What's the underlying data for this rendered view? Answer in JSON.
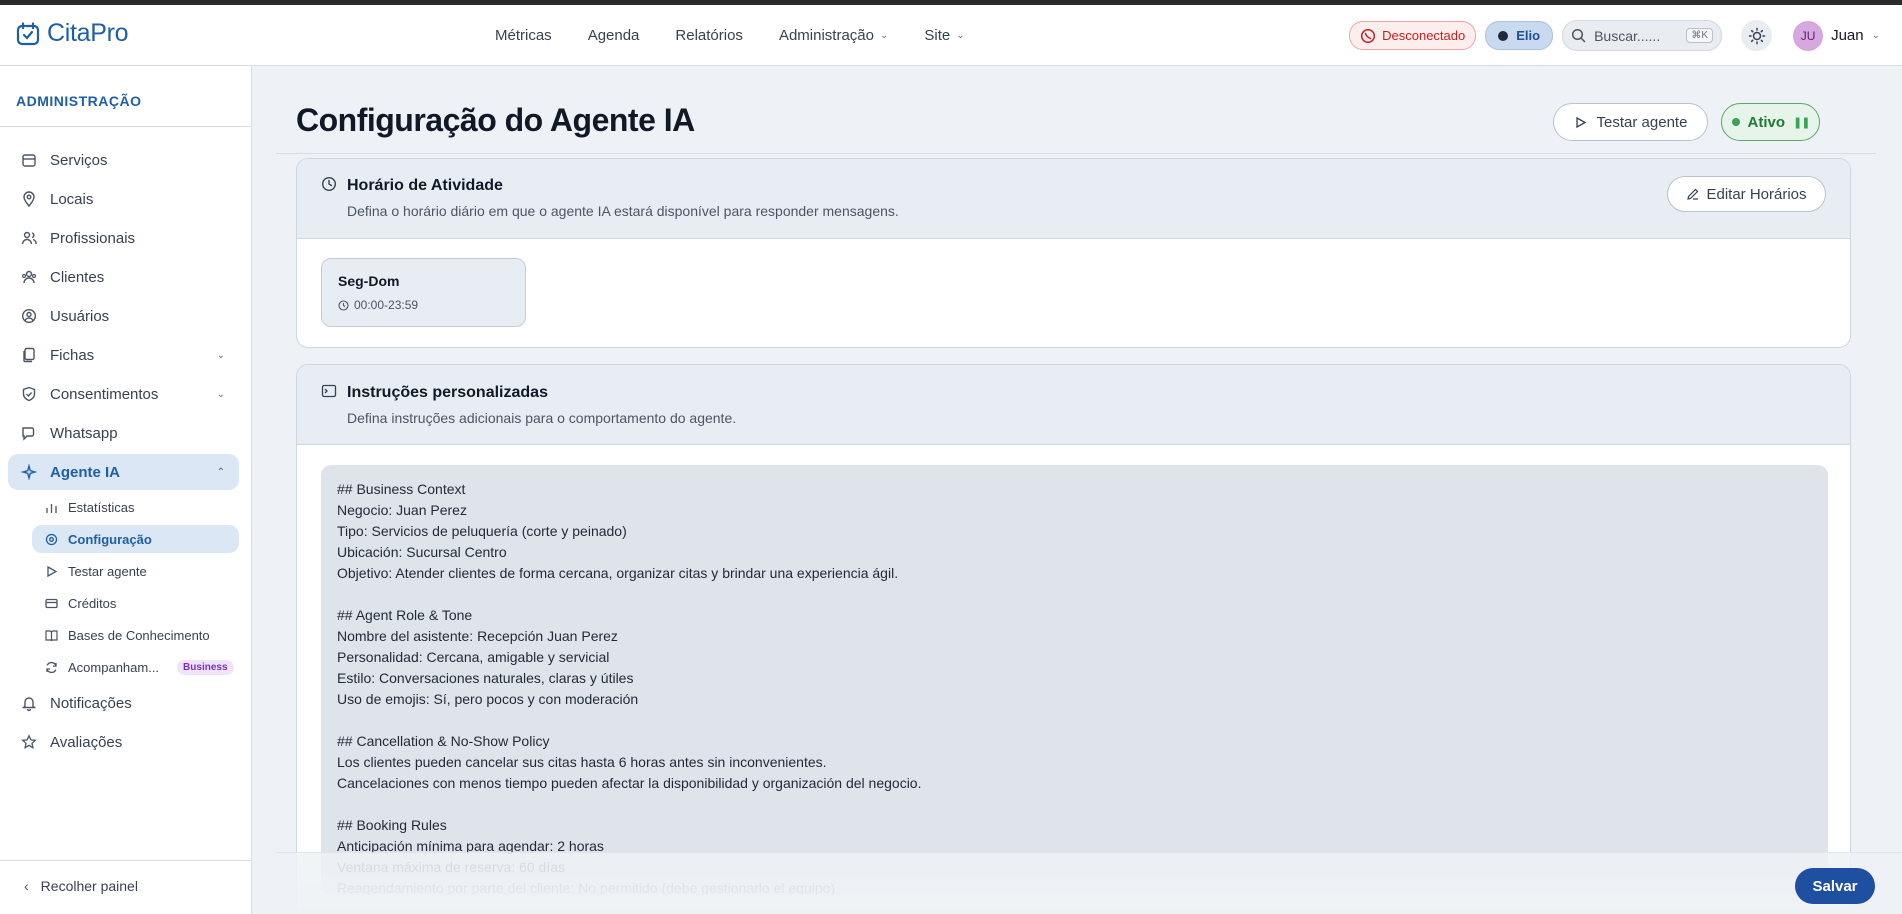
{
  "app": {
    "name": "CitaPro"
  },
  "nav": {
    "items": [
      {
        "label": "Métricas"
      },
      {
        "label": "Agenda"
      },
      {
        "label": "Relatórios"
      },
      {
        "label": "Administração"
      },
      {
        "label": "Site"
      }
    ]
  },
  "header": {
    "whatsapp_status": "Desconectado",
    "workspace": "Elio",
    "search_placeholder": "Buscar......",
    "search_shortcut": "⌘K",
    "user_initials": "JU",
    "user_name": "Juan"
  },
  "sidebar": {
    "section_title": "ADMINISTRAÇÃO",
    "items": [
      {
        "label": "Serviços",
        "icon": "box-icon"
      },
      {
        "label": "Locais",
        "icon": "location-pin-icon"
      },
      {
        "label": "Profissionais",
        "icon": "users-icon"
      },
      {
        "label": "Clientes",
        "icon": "people-icon"
      },
      {
        "label": "Usuários",
        "icon": "user-circle-icon"
      },
      {
        "label": "Fichas",
        "icon": "documents-icon"
      },
      {
        "label": "Consentimentos",
        "icon": "shield-icon"
      },
      {
        "label": "Whatsapp",
        "icon": "chat-icon"
      },
      {
        "label": "Agente IA",
        "icon": "sparkles-icon"
      },
      {
        "label": "Notificações",
        "icon": "bell-icon"
      },
      {
        "label": "Avaliações",
        "icon": "star-icon"
      }
    ],
    "sub_items": [
      {
        "label": "Estatísticas",
        "icon": "bar-chart-icon"
      },
      {
        "label": "Configuração",
        "icon": "settings-icon"
      },
      {
        "label": "Testar agente",
        "icon": "play-icon"
      },
      {
        "label": "Créditos",
        "icon": "card-icon"
      },
      {
        "label": "Bases de Conhecimento",
        "icon": "book-icon"
      },
      {
        "label": "Acompanham...",
        "icon": "refresh-icon",
        "badge": "Business"
      }
    ],
    "collapse_label": "Recolher painel"
  },
  "page": {
    "title": "Configuração do Agente IA",
    "test_button": "Testar agente",
    "status_label": "Ativo"
  },
  "schedule_card": {
    "title": "Horário de Atividade",
    "description": "Defina o horário diário em que o agente IA estará disponível para responder mensagens.",
    "edit_button": "Editar Horários",
    "slots": [
      {
        "days": "Seg-Dom",
        "time": "00:00-23:59"
      }
    ]
  },
  "instructions_card": {
    "title": "Instruções personalizadas",
    "description": "Defina instruções adicionais para o comportamento do agente.",
    "text": "## Business Context\nNegocio: Juan Perez\nTipo: Servicios de peluquería (corte y peinado)\nUbicación: Sucursal Centro\nObjetivo: Atender clientes de forma cercana, organizar citas y brindar una experiencia ágil.\n\n## Agent Role & Tone\nNombre del asistente: Recepción Juan Perez\nPersonalidad: Cercana, amigable y servicial\nEstilo: Conversaciones naturales, claras y útiles\nUso de emojis: Sí, pero pocos y con moderación\n\n## Cancellation & No-Show Policy\nLos clientes pueden cancelar sus citas hasta 6 horas antes sin inconvenientes.\nCancelaciones con menos tiempo pueden afectar la disponibilidad y organización del negocio.\n\n## Booking Rules\nAnticipación mínima para agendar: 2 horas\nVentana máxima de reserva: 60 días\nReagendamiento por parte del cliente: No permitido (debe gestionarlo el equipo)\nMostrar precios: No"
  },
  "footer": {
    "save_button": "Salvar"
  },
  "colors": {
    "accent": "#1f5fa7",
    "save": "#1f4fa0",
    "active_green": "#1f7a34",
    "danger": "#c81e1e"
  }
}
